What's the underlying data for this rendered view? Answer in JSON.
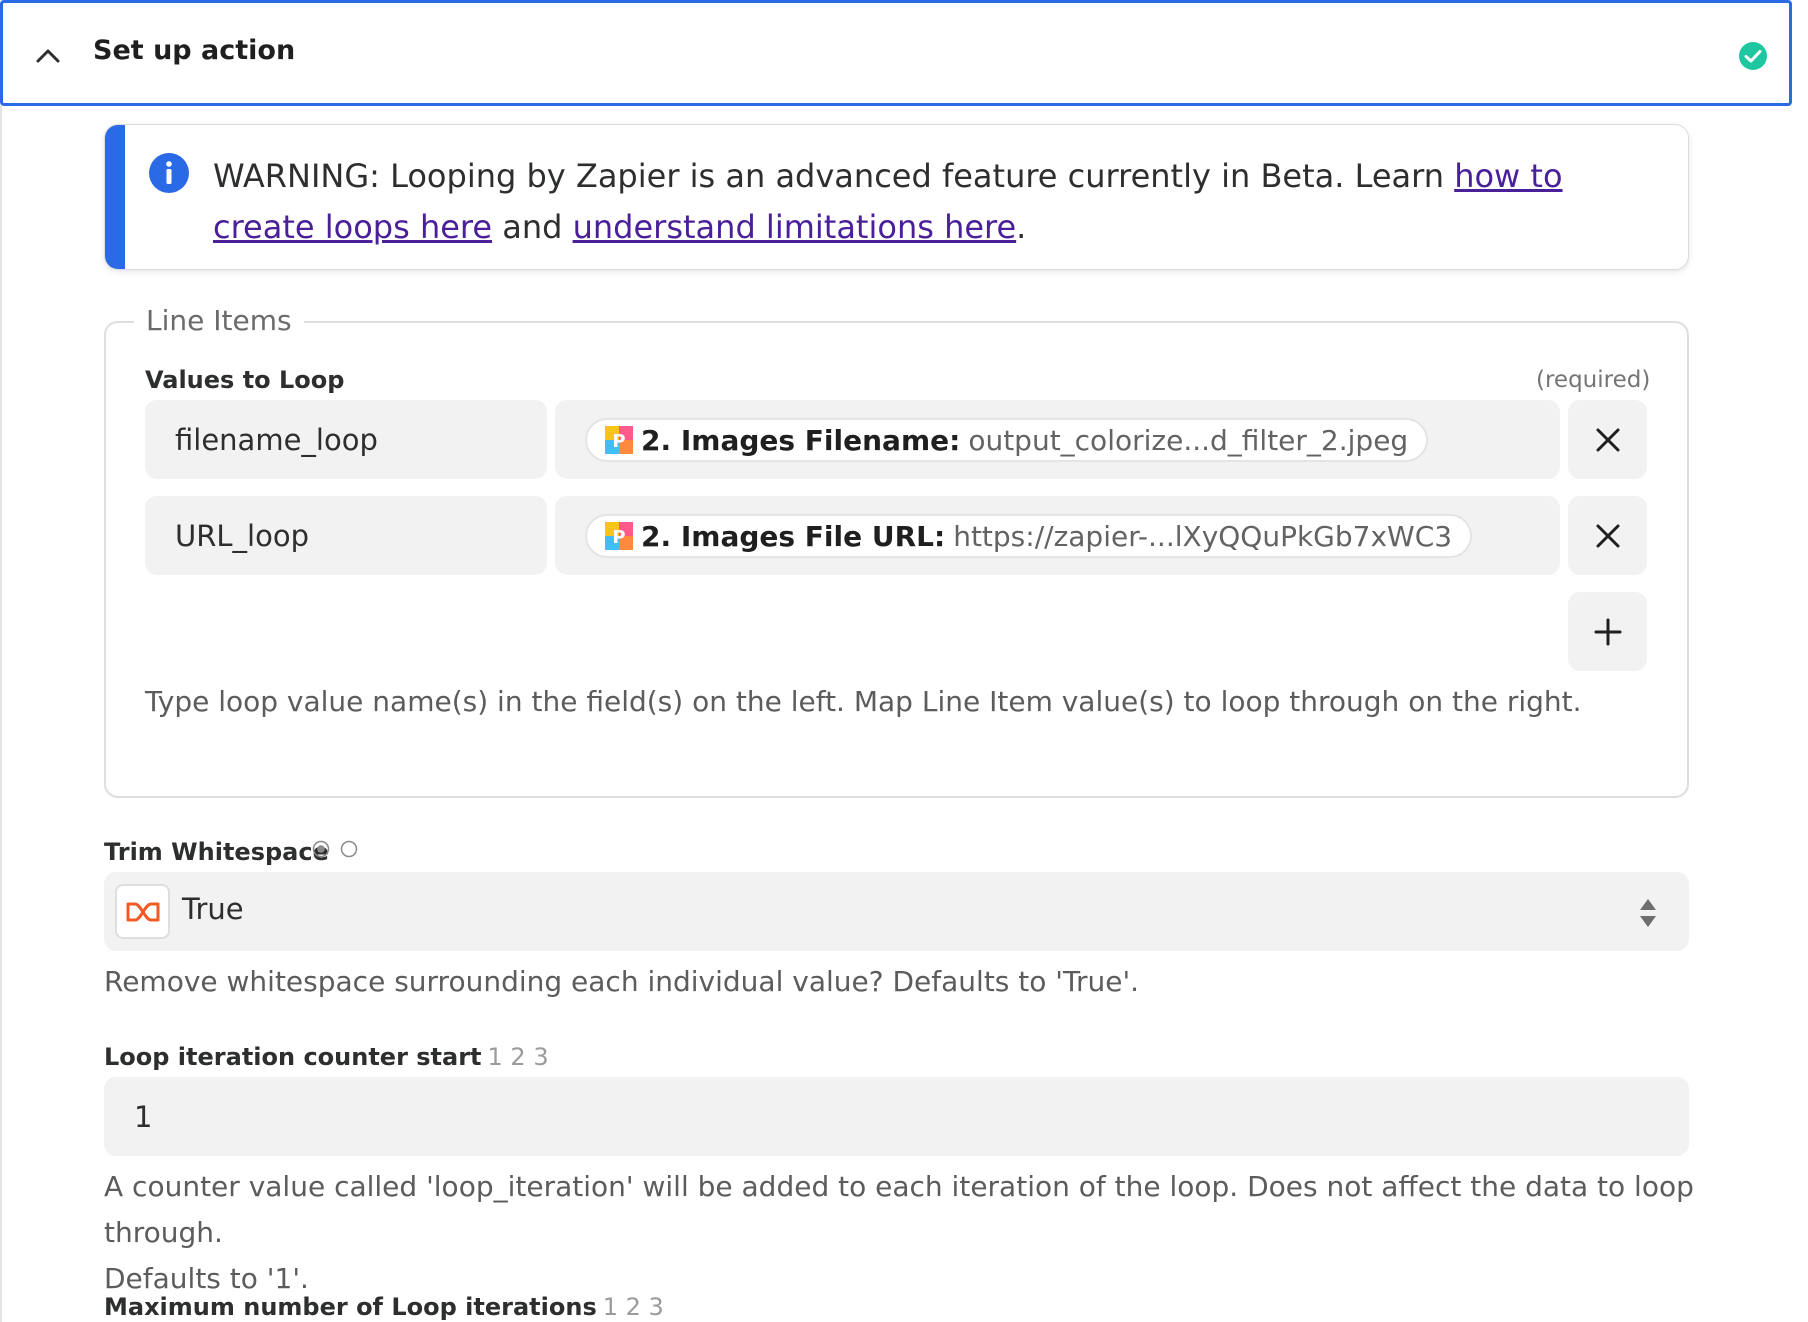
{
  "header": {
    "title": "Set up action",
    "status": "complete"
  },
  "warning": {
    "text_before": "WARNING: Looping by Zapier is an advanced feature currently in Beta. Learn ",
    "link1": "how to create loops here",
    "text_middle": " and ",
    "link2": "understand limitations here",
    "text_after": "."
  },
  "line_items": {
    "legend": "Line Items",
    "values_label": "Values to Loop",
    "required": "(required)",
    "rows": [
      {
        "key": "filename_loop",
        "pill_label": "2. Images Filename:",
        "pill_value": "output_colorize...d_filter_2.jpeg"
      },
      {
        "key": "URL_loop",
        "pill_label": "2. Images File URL:",
        "pill_value": "https://zapier-...lXyQQuPkGb7xWC3"
      }
    ],
    "helper": "Type loop value name(s) in the field(s) on the left. Map Line Item value(s) to loop through on the right."
  },
  "trim": {
    "label": "Trim Whitespace",
    "value": "True",
    "description": "Remove whitespace surrounding each individual value? Defaults to 'True'."
  },
  "counter": {
    "label": "Loop iteration counter start",
    "nums": "1 2 3",
    "value": "1",
    "description_line1": "A counter value called 'loop_iteration' will be added to each iteration of the loop. Does not affect the data to loop through.",
    "description_line2": "Defaults to '1'."
  },
  "max": {
    "label": "Maximum number of Loop iterations",
    "nums": "1 2 3"
  },
  "colors": {
    "accent": "#2b6ae6",
    "success": "#1fc7a0",
    "link": "#4a1f9a",
    "looping_icon": "#f15a24"
  },
  "icons": [
    "chevron-up-icon",
    "check-circle-icon",
    "info-icon",
    "app-icon",
    "close-icon",
    "plus-icon",
    "radio-icon",
    "looping-icon",
    "select-arrows-icon"
  ]
}
